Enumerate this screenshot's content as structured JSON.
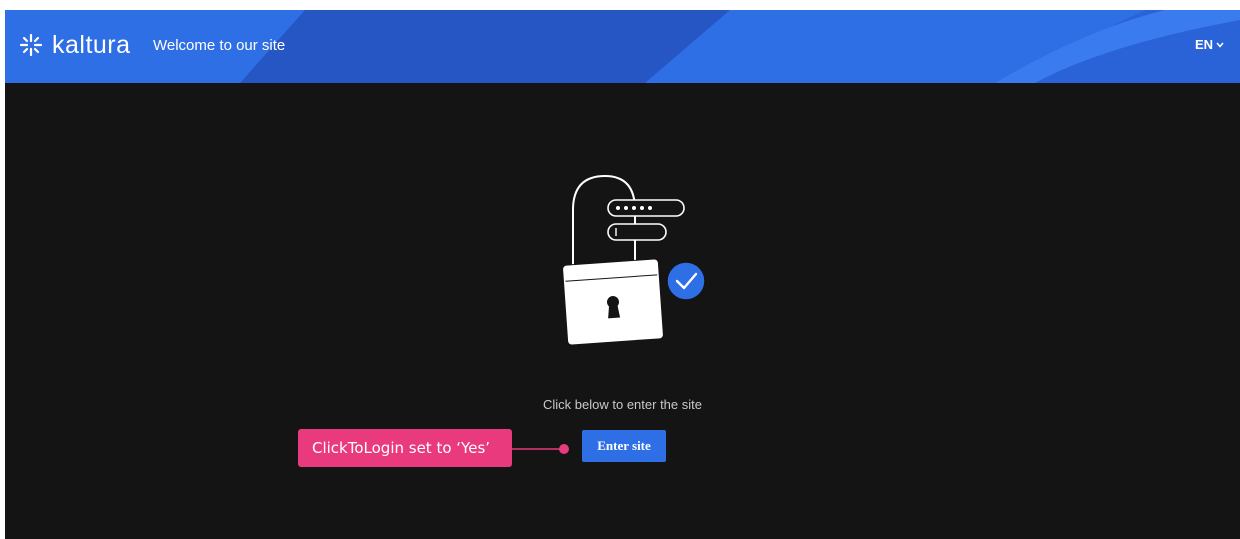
{
  "header": {
    "brand": "kaltura",
    "site_title": "Welcome to our site",
    "language": "EN",
    "brand_color": "#2f6fe6"
  },
  "main": {
    "instruction": "Click below to enter the site",
    "enter_button": "Enter site"
  },
  "annotation": {
    "callout_text": "ClickToLogin set to ‘Yes’",
    "callout_color": "#e83a7c"
  },
  "icons": [
    "kaltura-logo-icon",
    "chevron-down-icon",
    "padlock-illustration-icon",
    "check-icon"
  ]
}
